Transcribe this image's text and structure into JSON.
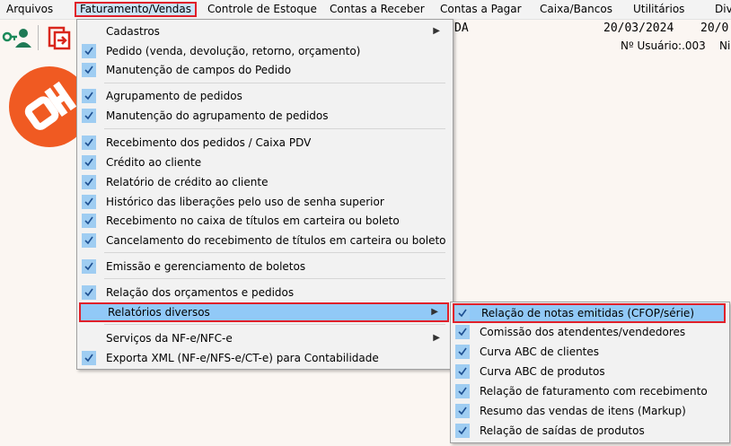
{
  "menubar": {
    "items": [
      "Arquivos",
      "Faturamento/Vendas",
      "Controle de Estoque",
      "Contas a Receber",
      "Contas a Pagar",
      "Caixa/Bancos",
      "Utilitários",
      "Div"
    ]
  },
  "status": {
    "company_tail": "DA",
    "date1": "20/03/2024",
    "date2": "20/0",
    "user_label": "Nº Usuário:.003",
    "user_tail": "Ni"
  },
  "main_menu": {
    "items": [
      {
        "label": "Cadastros",
        "checked": false,
        "submenu": true
      },
      {
        "label": "Pedido (venda, devolução, retorno, orçamento)",
        "checked": true
      },
      {
        "label": "Manutenção de campos do Pedido",
        "checked": true
      },
      {
        "label": "Agrupamento de pedidos",
        "checked": true
      },
      {
        "label": "Manutenção do agrupamento de pedidos",
        "checked": true
      },
      {
        "label": "Recebimento dos pedidos / Caixa PDV",
        "checked": true
      },
      {
        "label": "Crédito ao cliente",
        "checked": true
      },
      {
        "label": "Relatório de crédito ao cliente",
        "checked": true
      },
      {
        "label": "Histórico das liberações pelo uso de senha superior",
        "checked": true
      },
      {
        "label": "Recebimento no caixa de títulos em carteira ou boleto",
        "checked": true
      },
      {
        "label": "Cancelamento do recebimento de títulos em carteira ou boleto",
        "checked": true
      },
      {
        "label": "Emissão e gerenciamento de boletos",
        "checked": true
      },
      {
        "label": "Relação dos orçamentos e pedidos",
        "checked": true
      },
      {
        "label": "Relatórios diversos",
        "checked": false,
        "submenu": true,
        "highlighted": true
      },
      {
        "label": "Serviços da NF-e/NFC-e",
        "checked": false,
        "submenu": true
      },
      {
        "label": "Exporta XML (NF-e/NFS-e/CT-e) para Contabilidade",
        "checked": true
      }
    ]
  },
  "sub_menu": {
    "items": [
      {
        "label": "Relação de notas emitidas (CFOP/série)",
        "highlighted": true
      },
      {
        "label": "Comissão dos atendentes/vendedores"
      },
      {
        "label": "Curva ABC de clientes"
      },
      {
        "label": "Curva ABC de produtos"
      },
      {
        "label": "Relação de faturamento com recebimento"
      },
      {
        "label": "Resumo das vendas de itens (Markup)"
      },
      {
        "label": "Relação de saídas de produtos"
      }
    ]
  },
  "icons": {
    "key_user": "key-user-icon",
    "exit": "exit-icon",
    "check": "check-icon",
    "submenu_arrow": "submenu-arrow-icon",
    "logo": "brand-logo"
  },
  "colors": {
    "menu_highlight": "#91c9f7",
    "check_bg": "#9fcdf2",
    "red_outline": "#e0202a",
    "logo_orange": "#f05a22"
  }
}
